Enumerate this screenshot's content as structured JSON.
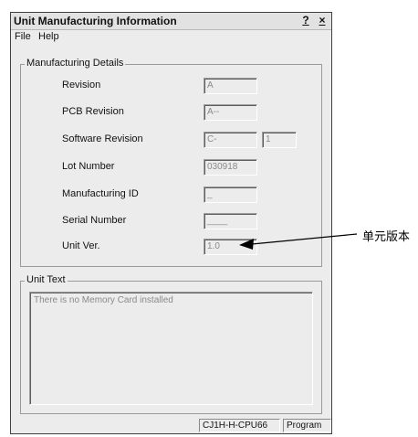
{
  "window": {
    "title": "Unit Manufacturing Information",
    "help_button": "?",
    "close_button": "×"
  },
  "menu": [
    "File",
    "Help"
  ],
  "manufacturing_details": {
    "legend": "Manufacturing Details",
    "revision": {
      "label": "Revision",
      "value": "A"
    },
    "pcb_revision": {
      "label": "PCB Revision",
      "value": "A--"
    },
    "software_revision": {
      "label": "Software Revision",
      "value": "C-",
      "value2": "1"
    },
    "lot_number": {
      "label": "Lot Number",
      "value": "030918"
    },
    "manufacturing_id": {
      "label": "Manufacturing ID",
      "value": "_"
    },
    "serial_number": {
      "label": "Serial Number",
      "value": "____"
    },
    "unit_ver": {
      "label": "Unit Ver.",
      "value": "1.0"
    }
  },
  "unit_text": {
    "legend": "Unit Text",
    "content": "There is no Memory Card installed"
  },
  "status": {
    "model": "CJ1H-H-CPU66",
    "mode": "Program"
  },
  "annotation": {
    "label": "单元版本"
  }
}
